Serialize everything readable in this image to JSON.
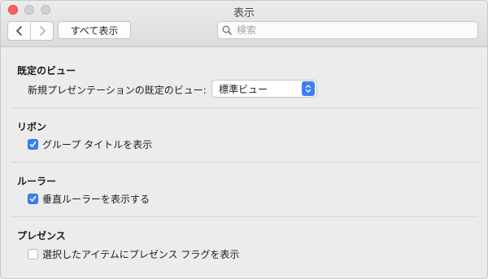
{
  "window": {
    "title": "表示"
  },
  "toolbar": {
    "show_all_label": "すべて表示",
    "search_placeholder": "検索"
  },
  "sections": {
    "default_view": {
      "title": "既定のビュー",
      "label": "新規プレゼンテーションの既定のビュー:",
      "selected_option": "標準ビュー"
    },
    "ribbon": {
      "title": "リボン",
      "checkbox_label": "グループ タイトルを表示",
      "checked": true
    },
    "ruler": {
      "title": "ルーラー",
      "checkbox_label": "垂直ルーラーを表示する",
      "checked": true
    },
    "presence": {
      "title": "プレゼンス",
      "checkbox_label": "選択したアイテムにプレゼンス フラグを表示",
      "checked": false
    }
  },
  "colors": {
    "accent": "#3b7ff5",
    "close": "#fc605c",
    "background": "#ececec"
  },
  "icons": [
    "back-icon",
    "forward-icon",
    "search-icon",
    "checkmark-icon",
    "popup-arrows-icon"
  ]
}
